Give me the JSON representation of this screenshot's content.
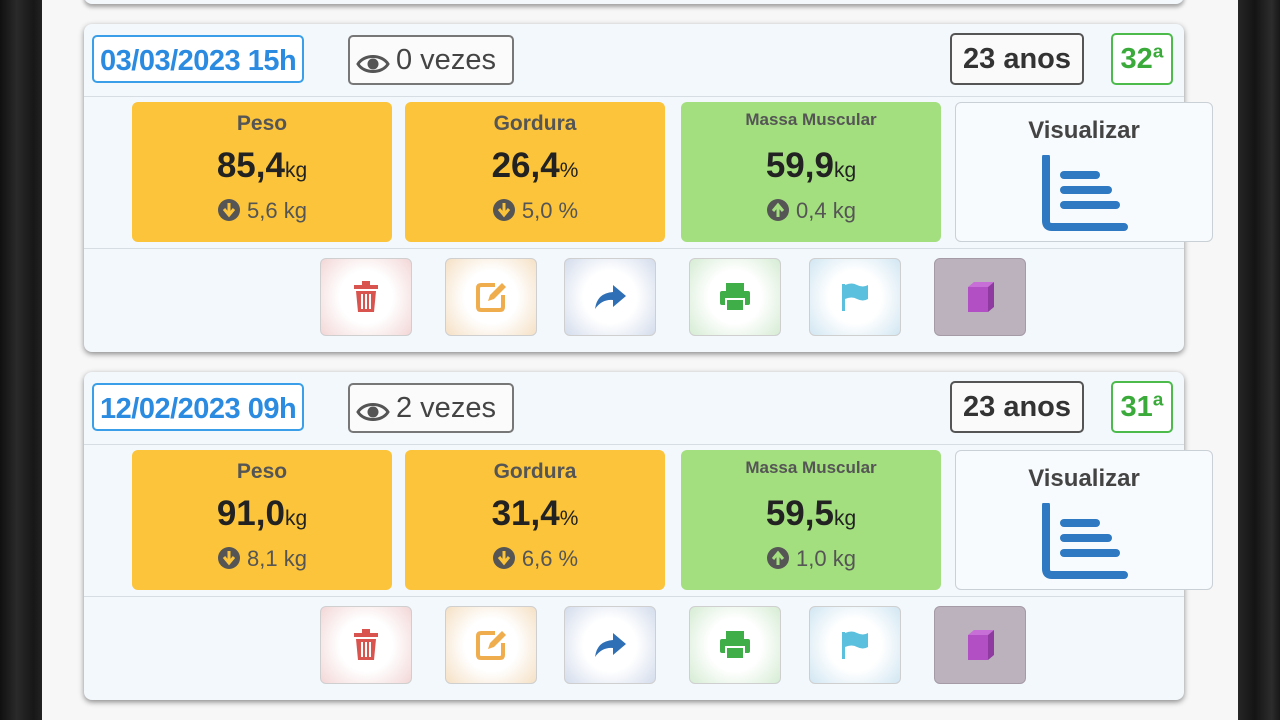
{
  "records": [
    {
      "date": "03/03/2023 15h",
      "views": "0 vezes",
      "age": "23 anos",
      "ordinal": "32ª",
      "peso": {
        "label": "Peso",
        "value": "85,4",
        "unit": "kg",
        "delta": "5,6 kg",
        "direction": "down"
      },
      "gordura": {
        "label": "Gordura",
        "value": "26,4",
        "unit": "%",
        "delta": "5,0 %",
        "direction": "down"
      },
      "massa": {
        "label": "Massa Muscular",
        "value": "59,9",
        "unit": "kg",
        "delta": "0,4 kg",
        "direction": "up"
      },
      "visualizar": "Visualizar"
    },
    {
      "date": "12/02/2023 09h",
      "views": "2 vezes",
      "age": "23 anos",
      "ordinal": "31ª",
      "peso": {
        "label": "Peso",
        "value": "91,0",
        "unit": "kg",
        "delta": "8,1 kg",
        "direction": "down"
      },
      "gordura": {
        "label": "Gordura",
        "value": "31,4",
        "unit": "%",
        "delta": "6,6 %",
        "direction": "down"
      },
      "massa": {
        "label": "Massa Muscular",
        "value": "59,5",
        "unit": "kg",
        "delta": "1,0 kg",
        "direction": "up"
      },
      "visualizar": "Visualizar"
    }
  ],
  "icons": {
    "delete": "trash-icon",
    "edit": "edit-icon",
    "share": "share-icon",
    "print": "print-icon",
    "flag": "flag-icon",
    "book": "book-icon",
    "views": "eye-icon",
    "chart": "bar-chart-icon"
  },
  "colors": {
    "date": "#2a8be0",
    "ordinal": "#3aaa3a",
    "metric_warning": "#fbc43a",
    "metric_good": "#a3df7e",
    "delete": "#d9534f",
    "edit": "#f0ad4e",
    "share": "#2f6fb5",
    "print": "#3fae49",
    "flag": "#5bc0de",
    "book": "#b24fc4"
  }
}
